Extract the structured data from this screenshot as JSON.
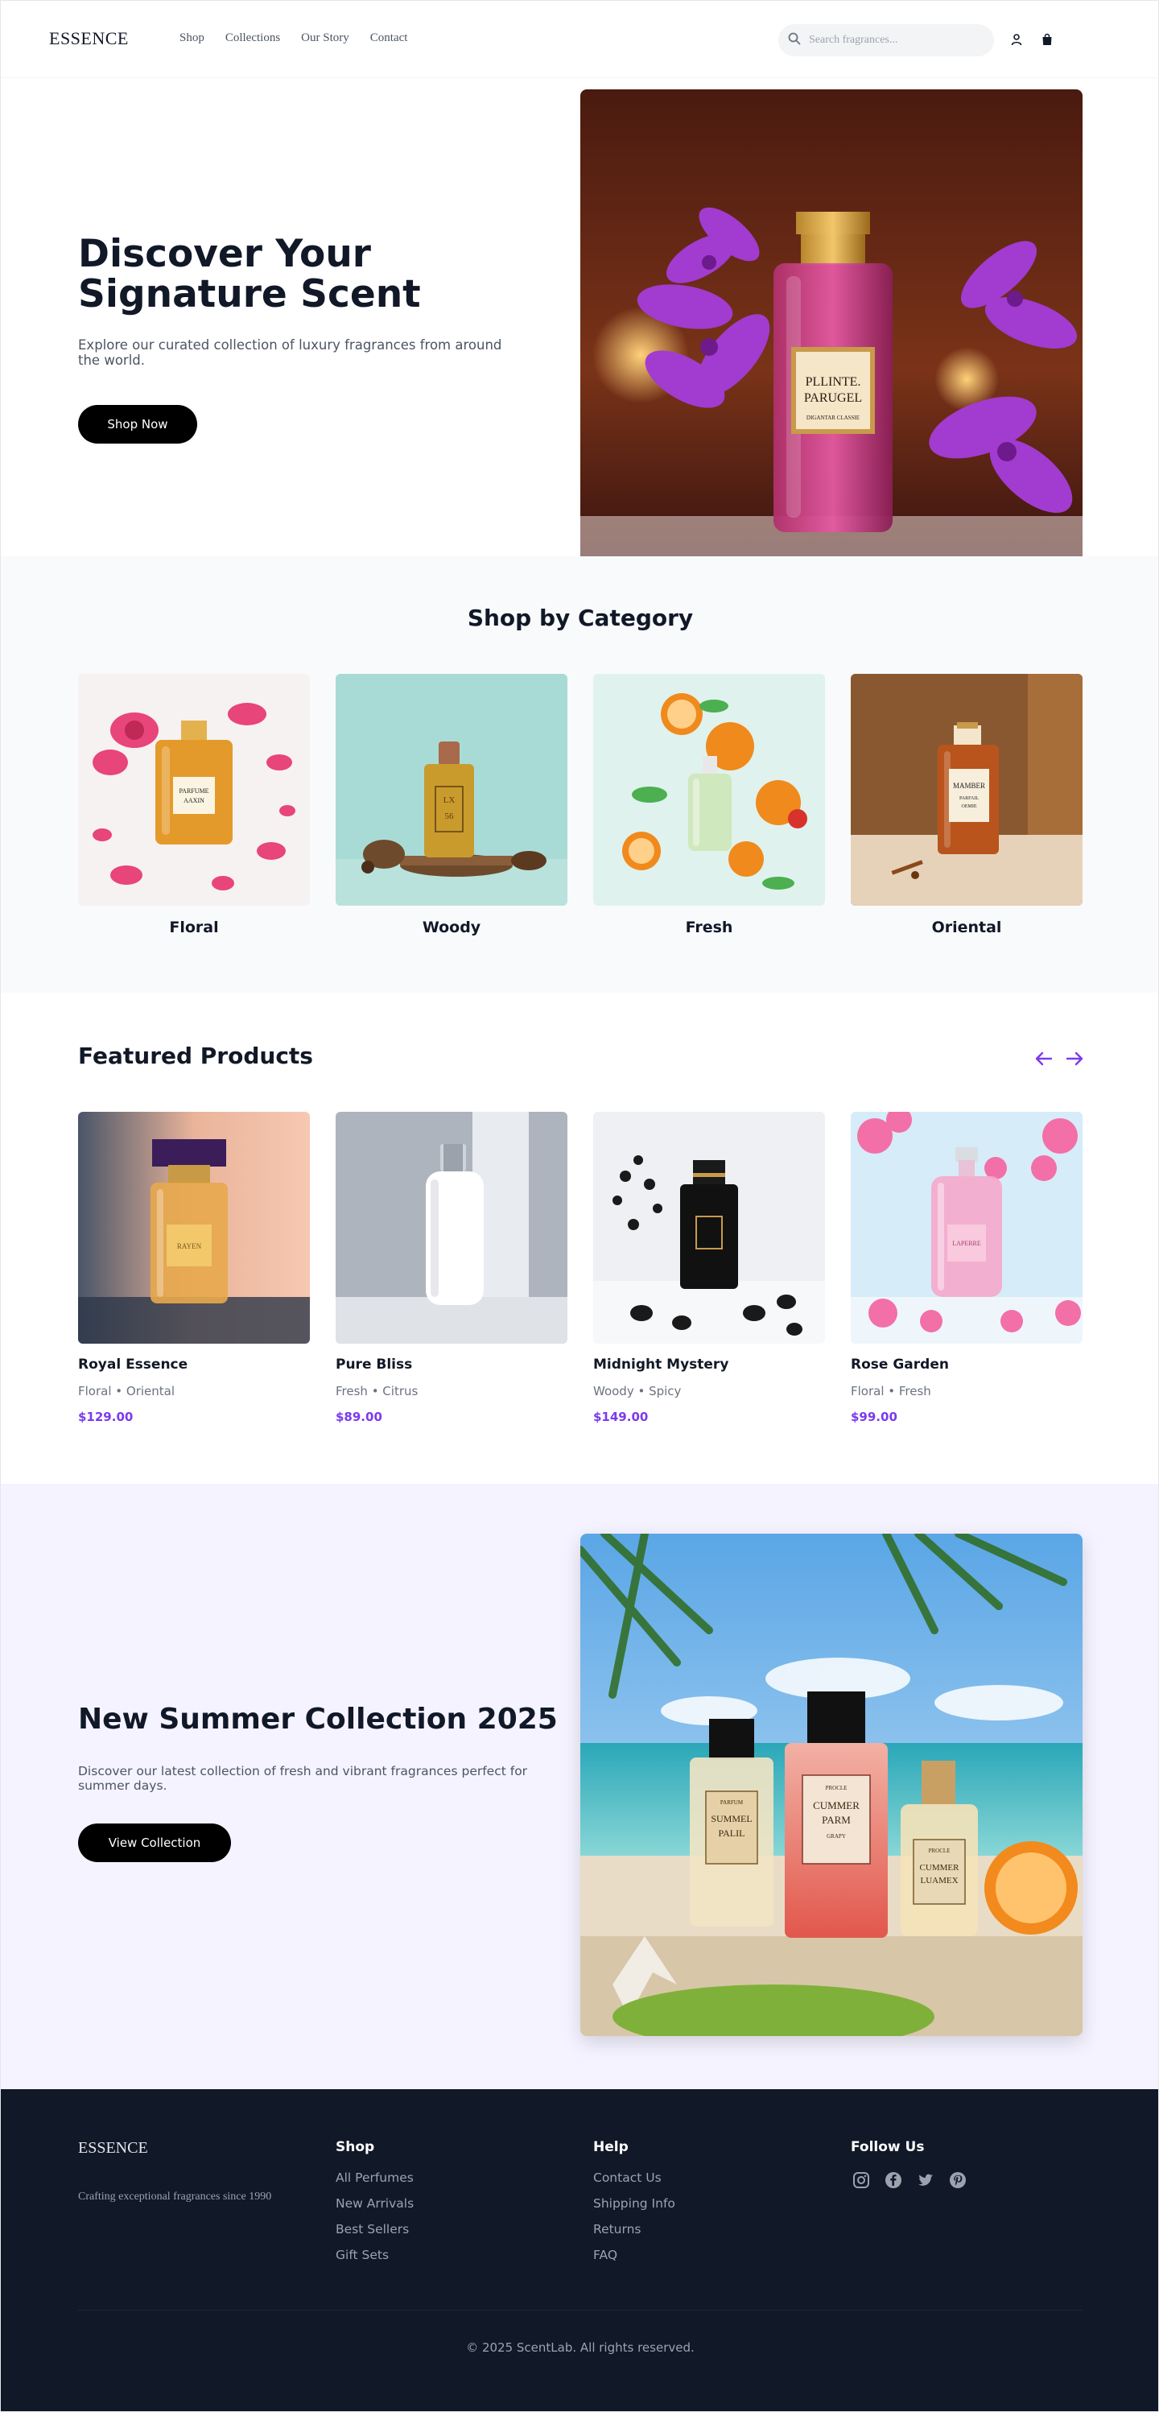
{
  "header": {
    "logo": "ESSENCE",
    "nav": [
      "Shop",
      "Collections",
      "Our Story",
      "Contact"
    ],
    "search_placeholder": "Search fragrances...",
    "icons": [
      "search-icon",
      "user-icon",
      "shopping-bag-icon"
    ]
  },
  "hero": {
    "title": "Discover Your Signature Scent",
    "subtitle": "Explore our curated collection of luxury fragrances from around the world.",
    "button": "Shop Now",
    "bottle_label_line1": "PLLINTE.",
    "bottle_label_line2": "PARUGEL",
    "bottle_label_line3": "DIGANTAR CLASSIE"
  },
  "categories": {
    "title": "Shop by Category",
    "items": [
      {
        "name": "Floral",
        "label": [
          "PARFUME",
          "AAXIN"
        ]
      },
      {
        "name": "Woody",
        "label": [
          "LX",
          "56"
        ]
      },
      {
        "name": "Fresh"
      },
      {
        "name": "Oriental",
        "label": [
          "MAMBER",
          "PARFAIL",
          "OEMIE"
        ]
      }
    ]
  },
  "featured": {
    "title": "Featured Products",
    "products": [
      {
        "name": "Royal Essence",
        "tags": "Floral • Oriental",
        "price": "$129.00",
        "label": "RAYEN"
      },
      {
        "name": "Pure Bliss",
        "tags": "Fresh • Citrus",
        "price": "$89.00"
      },
      {
        "name": "Midnight Mystery",
        "tags": "Woody • Spicy",
        "price": "$149.00"
      },
      {
        "name": "Rose Garden",
        "tags": "Floral • Fresh",
        "price": "$99.00",
        "label": "LAPERRE"
      }
    ]
  },
  "summer": {
    "title": "New Summer Collection 2025",
    "subtitle": "Discover our latest collection of fresh and vibrant fragrances perfect for summer days.",
    "button": "View Collection",
    "bottles": [
      {
        "top": "PARFUM",
        "line1": "SUMMEL",
        "line2": "PALIL"
      },
      {
        "top": "PROCLE",
        "line1": "CUMMER",
        "line2": "PARM",
        "line3": "GRAPY"
      },
      {
        "top": "PROCLE",
        "line1": "CUMMER",
        "line2": "LUAMEX"
      }
    ]
  },
  "footer": {
    "logo": "ESSENCE",
    "tagline": "Crafting exceptional fragrances since 1990",
    "shop": {
      "title": "Shop",
      "links": [
        "All Perfumes",
        "New Arrivals",
        "Best Sellers",
        "Gift Sets"
      ]
    },
    "help": {
      "title": "Help",
      "links": [
        "Contact Us",
        "Shipping Info",
        "Returns",
        "FAQ"
      ]
    },
    "follow": {
      "title": "Follow Us",
      "icons": [
        "instagram-icon",
        "facebook-icon",
        "twitter-icon",
        "pinterest-icon"
      ]
    },
    "copyright": "© 2025 ScentLab. All rights reserved."
  },
  "colors": {
    "accent": "#7c3aed",
    "footer_bg": "#111827",
    "category_bg": "#f9fafb",
    "summer_bg": "#f5f3ff",
    "button": "#000000"
  }
}
